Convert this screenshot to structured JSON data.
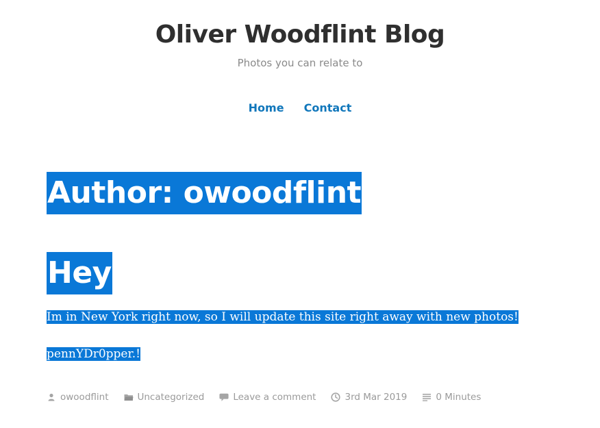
{
  "header": {
    "site_title": "Oliver Woodflint Blog",
    "tagline": "Photos you can relate to"
  },
  "nav": {
    "items": [
      {
        "label": "Home"
      },
      {
        "label": "Contact"
      }
    ]
  },
  "archive": {
    "title": "Author: owoodflint"
  },
  "post": {
    "title": "Hey",
    "paragraphs": [
      "Im in New York right now, so I will update this site right away with new photos!",
      "pennYDr0pper.!"
    ],
    "meta": {
      "author": "owoodflint",
      "category": "Uncategorized",
      "comments": "Leave a comment",
      "date": "3rd Mar 2019",
      "reading_time": "0 Minutes"
    }
  },
  "colors": {
    "link": "#1177bb",
    "selection": "#0a78d7",
    "meta_text": "#9a9a9a",
    "title_text": "#2f2f2f"
  },
  "icons": {
    "author": "person-icon",
    "category": "folder-icon",
    "comments": "speech-bubble-icon",
    "date": "clock-icon",
    "reading_time": "reading-lines-icon"
  }
}
